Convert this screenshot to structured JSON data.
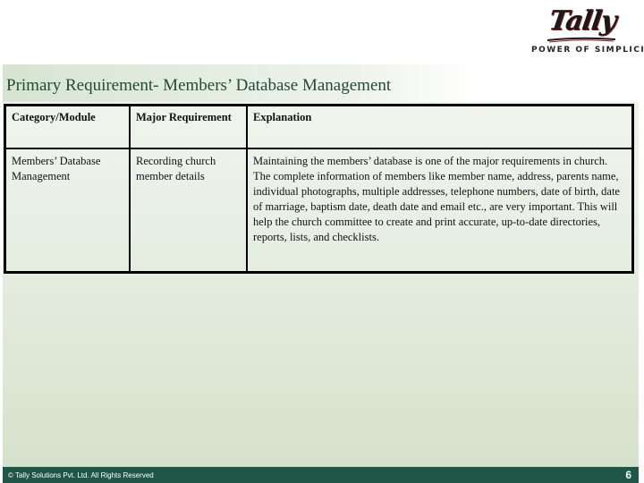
{
  "logo": {
    "word": "Tally",
    "tagline": "POWER OF SIMPLICITY"
  },
  "slide": {
    "title": "Primary Requirement- Members’ Database Management"
  },
  "table": {
    "headers": [
      "Category/Module",
      "Major Requirement",
      "Explanation"
    ],
    "rows": [
      {
        "category": "Members’ Database Management",
        "requirement": "Recording church member details",
        "explanation": "Maintaining the members’ database is one of the major requirements in church. The complete information of members like member name, address, parents name, individual photographs, multiple addresses, telephone numbers, date of birth, date of marriage, baptism date, death date and email etc., are very important. This will help the church committee to create and print accurate, up-to-date directories, reports, lists, and checklists."
      }
    ]
  },
  "footer": {
    "copyright": "© Tally Solutions Pvt. Ltd. All Rights Reserved",
    "page_number": "6"
  },
  "colors": {
    "title_text": "#234a36",
    "footer_bg": "#1f5646",
    "logo_accent": "#8b1a1a"
  }
}
